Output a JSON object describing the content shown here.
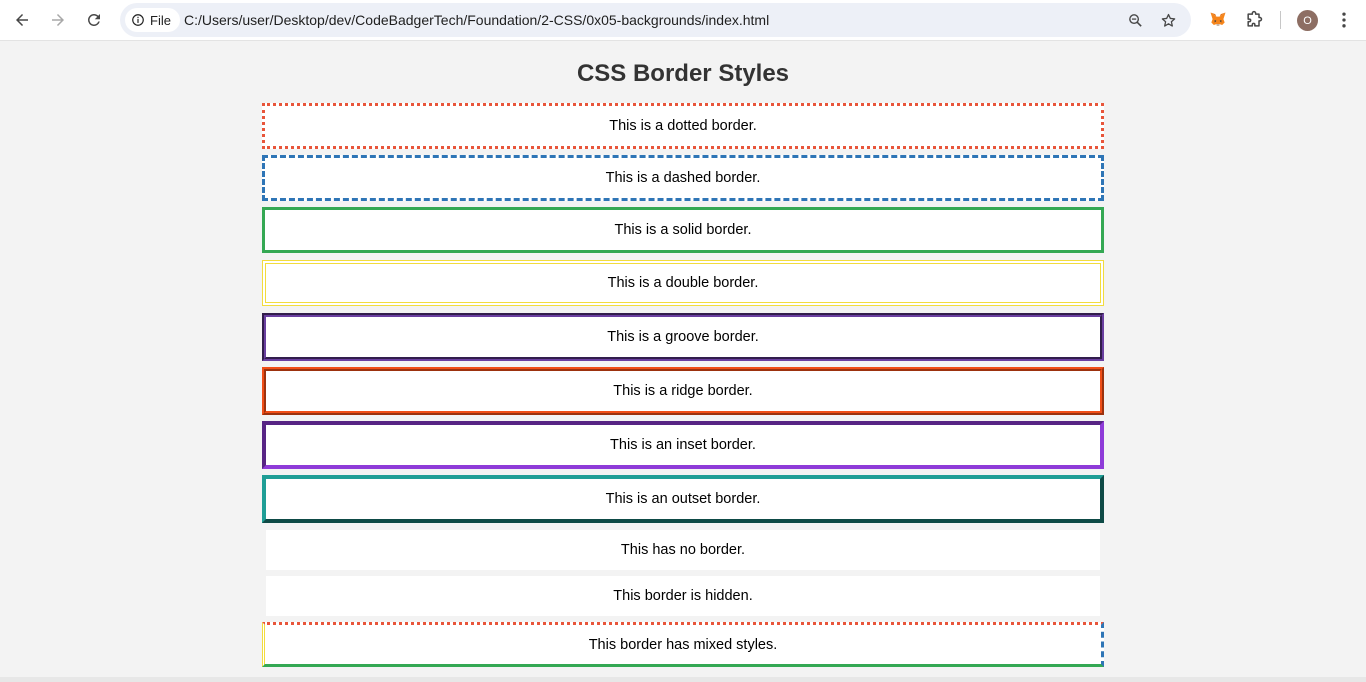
{
  "browser": {
    "site_chip_label": "File",
    "url": "C:/Users/user/Desktop/dev/CodeBadgerTech/Foundation/2-CSS/0x05-backgrounds/index.html",
    "profile_initial": "O"
  },
  "page": {
    "title": "CSS Border Styles",
    "boxes": [
      {
        "text": "This is a dotted border.",
        "style": "dotted",
        "color": "#e8553a"
      },
      {
        "text": "This is a dashed border.",
        "style": "dashed",
        "color": "#2e75b6"
      },
      {
        "text": "This is a solid border.",
        "style": "solid",
        "color": "#34a853"
      },
      {
        "text": "This is a double border.",
        "style": "double",
        "color": "#f2dc3d"
      },
      {
        "text": "This is a groove border.",
        "style": "groove",
        "color": "#6a3fa0"
      },
      {
        "text": "This is a ridge border.",
        "style": "ridge",
        "color": "#f04e17"
      },
      {
        "text": "This is an inset border.",
        "style": "inset",
        "color": "#8e3bd8"
      },
      {
        "text": "This is an outset border.",
        "style": "outset",
        "color": "#1f9e96"
      },
      {
        "text": "This has no border.",
        "style": "none",
        "color": ""
      },
      {
        "text": "This border is hidden.",
        "style": "hidden",
        "color": ""
      },
      {
        "text": "This border has mixed styles.",
        "style": "mixed",
        "color": ""
      }
    ]
  },
  "icons": {
    "back": "back-arrow-icon",
    "forward": "forward-arrow-icon",
    "reload": "reload-icon",
    "info": "info-icon",
    "zoom": "zoom-icon",
    "bookmark": "star-icon",
    "metamask": "metamask-fox-icon",
    "extensions": "puzzle-icon",
    "menu": "kebab-menu-icon"
  }
}
